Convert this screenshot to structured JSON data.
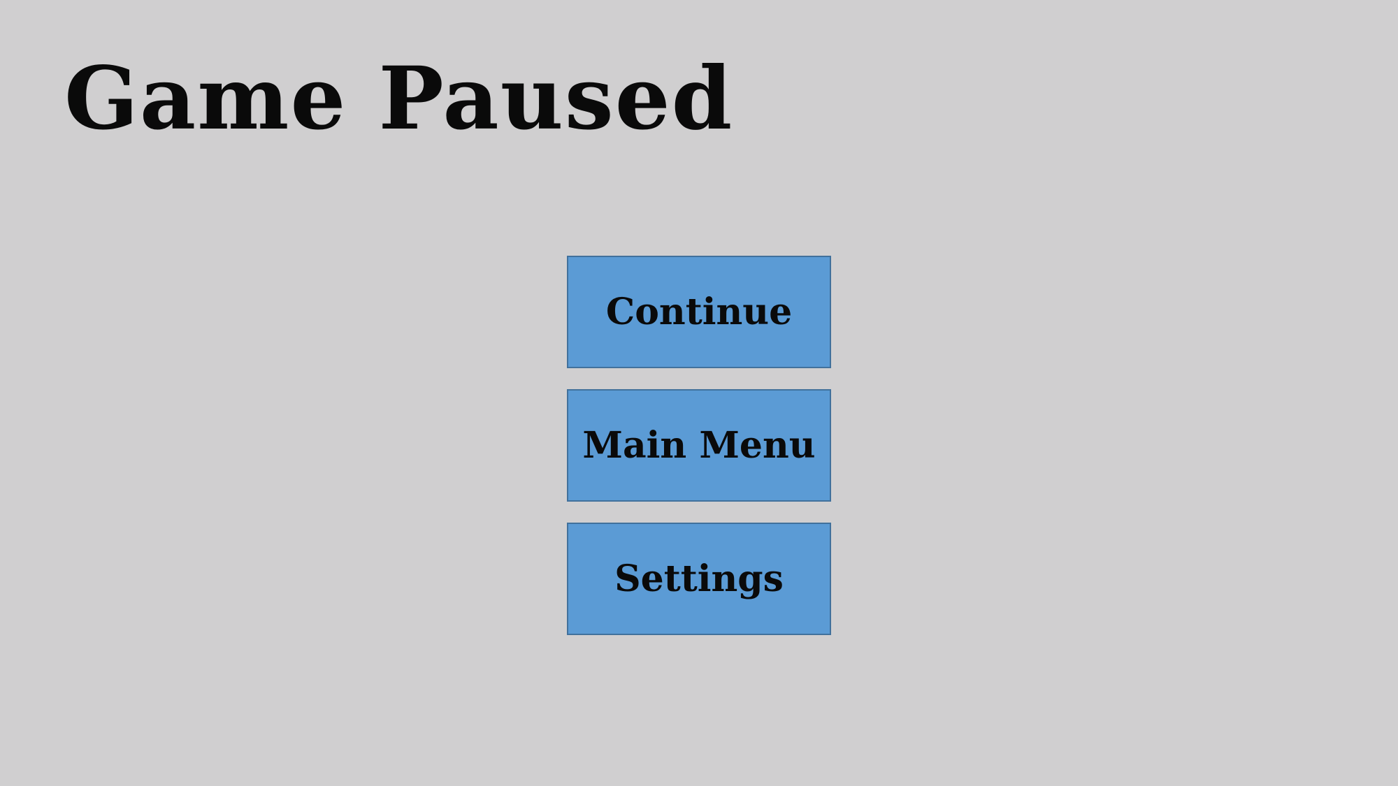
{
  "title": "Game Paused",
  "menu": {
    "continue_label": "Continue",
    "main_menu_label": "Main Menu",
    "settings_label": "Settings"
  },
  "colors": {
    "background": "#d0cfd0",
    "button_fill": "#5b9bd5",
    "button_border": "#41719c",
    "text": "#0a0a0a"
  }
}
